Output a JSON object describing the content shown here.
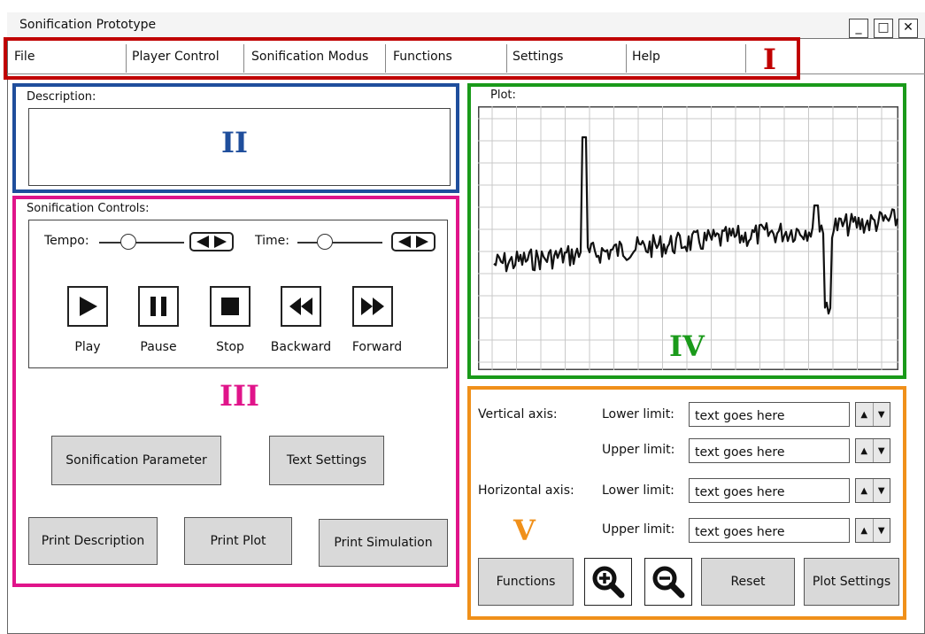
{
  "window": {
    "title": "Sonification Prototype",
    "controls": [
      "_",
      "□",
      "✕"
    ]
  },
  "menu": {
    "items": [
      "File",
      "Player Control",
      "Sonification Modus",
      "Functions",
      "Settings",
      "Help"
    ],
    "marker": "I",
    "marker_color": "#c00000"
  },
  "description": {
    "label": "Description:",
    "marker": "II",
    "marker_color": "#1f4e9c"
  },
  "controls": {
    "label": "Sonification Controls:",
    "tempo_label": "Tempo:",
    "time_label": "Time:",
    "player_buttons": [
      "Play",
      "Pause",
      "Stop",
      "Backward",
      "Forward"
    ],
    "marker": "III",
    "marker_color": "#e0148a",
    "sonification_parameter": "Sonification Parameter",
    "text_settings": "Text Settings",
    "print_description": "Print Description",
    "print_plot": "Print Plot",
    "print_simulation": "Print Simulation"
  },
  "plot": {
    "label": "Plot:",
    "marker": "IV",
    "marker_color": "#1a9a1a"
  },
  "axes": {
    "marker": "V",
    "marker_color": "#f0901a",
    "vertical_label": "Vertical axis:",
    "horizontal_label": "Horizontal axis:",
    "lower_label": "Lower limit:",
    "upper_label": "Upper limit:",
    "vertical_lower_value": "text goes here",
    "vertical_upper_value": "text goes here",
    "horizontal_lower_value": "text goes here",
    "horizontal_upper_value": "text goes here",
    "functions_button": "Functions",
    "reset_button": "Reset",
    "plot_settings_button": "Plot Settings"
  },
  "colors": {
    "region_I": "#c00000",
    "region_II": "#1f4e9c",
    "region_III": "#e0148a",
    "region_IV": "#1a9a1a",
    "region_V": "#f0901a"
  },
  "icons": [
    "play-icon",
    "pause-icon",
    "stop-icon",
    "rewind-icon",
    "fast-forward-icon",
    "zoom-in-icon",
    "zoom-out-icon",
    "arrow-left-right-icon"
  ]
}
